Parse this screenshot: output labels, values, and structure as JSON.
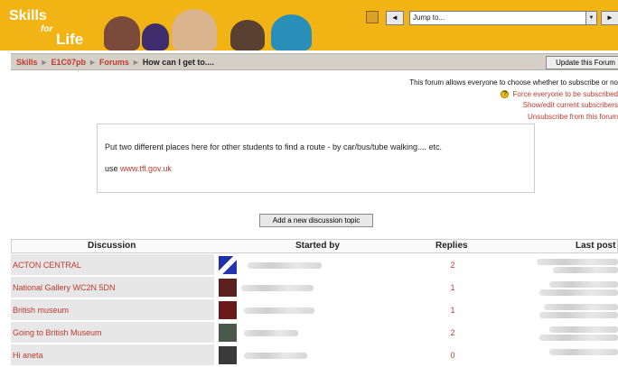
{
  "header": {
    "logo": {
      "line1": "Skills",
      "line2": "for",
      "line3": "Life"
    },
    "jump": {
      "value": "Jump to...",
      "prev_label": "◄",
      "next_label": "►"
    }
  },
  "breadcrumb": {
    "items": [
      "Skills",
      "E1C07pb",
      "Forums"
    ],
    "current": "How can I get to....",
    "separator": "►"
  },
  "update_button": "Update this Forum",
  "subscribe": {
    "info": "This forum allows everyone to choose whether to subscribe or no",
    "force": "Force everyone to be subscribed",
    "show_edit": "Show/edit current subscribers",
    "unsubscribe": "Unsubscribe from this forum"
  },
  "intro": {
    "text": "Put two different places here for other students to find a route - by car/bus/tube walking.... etc.",
    "use_prefix": "use ",
    "link": "www.tfl.gov.uk"
  },
  "add_topic_button": "Add a new discussion topic",
  "table": {
    "headers": {
      "discussion": "Discussion",
      "started_by": "Started by",
      "replies": "Replies",
      "last_post": "Last post"
    },
    "rows": [
      {
        "discussion": "ACTON CENTRAL",
        "replies": "2"
      },
      {
        "discussion": "National Gallery WC2N 5DN",
        "replies": "1"
      },
      {
        "discussion": "British museum",
        "replies": "1"
      },
      {
        "discussion": "Going to British Museum",
        "replies": "2"
      },
      {
        "discussion": "Hi aneta",
        "replies": "0"
      }
    ]
  },
  "colors": {
    "banner": "#f2b414",
    "link": "#c0392b",
    "crumbbar": "#d4d0c8"
  }
}
